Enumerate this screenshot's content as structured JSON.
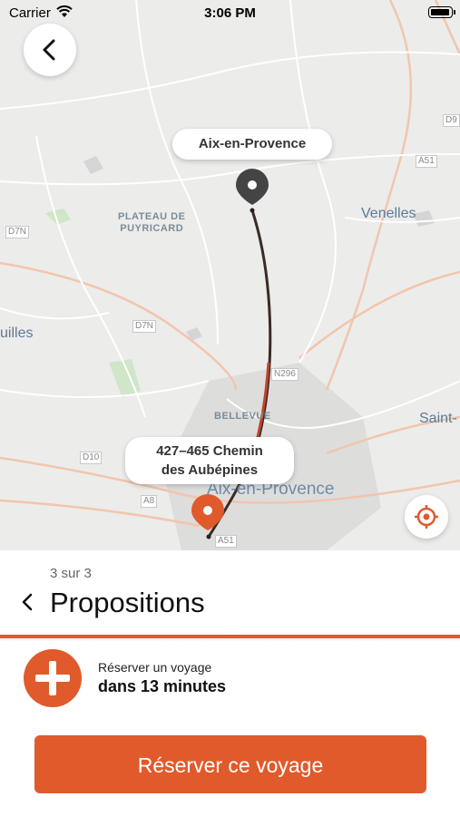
{
  "status_bar": {
    "carrier": "Carrier",
    "time": "3:06 PM"
  },
  "map": {
    "destination_label": "Aix-en-Provence",
    "origin_label_line1": "427–465 Chemin",
    "origin_label_line2": "des Aubépines",
    "place_labels": {
      "plateau_line1": "PLATEAU DE",
      "plateau_line2": "PUYRICARD",
      "bellevue": "BELLEVUE",
      "venelles": "Venelles",
      "uilles": "uilles",
      "saint": "Saint-",
      "aix_city": "Aix-en-Provence"
    },
    "road_labels": {
      "d7n_a": "D7N",
      "d7n_b": "D7N",
      "d10": "D10",
      "a8": "A8",
      "a51_a": "A51",
      "a51_b": "A51",
      "n296": "N296",
      "d9": "D9"
    },
    "colors": {
      "route": "#3a2a26",
      "route_accent": "#c0432a",
      "origin_pin": "#e05a2c",
      "destination_pin": "#444444"
    }
  },
  "sheet": {
    "counter": "3 sur 3",
    "title": "Propositions",
    "book_label": "Réserver un voyage",
    "book_time": "dans 13 minutes",
    "cta_label": "Réserver ce voyage"
  },
  "accent_color": "#e05a2c"
}
